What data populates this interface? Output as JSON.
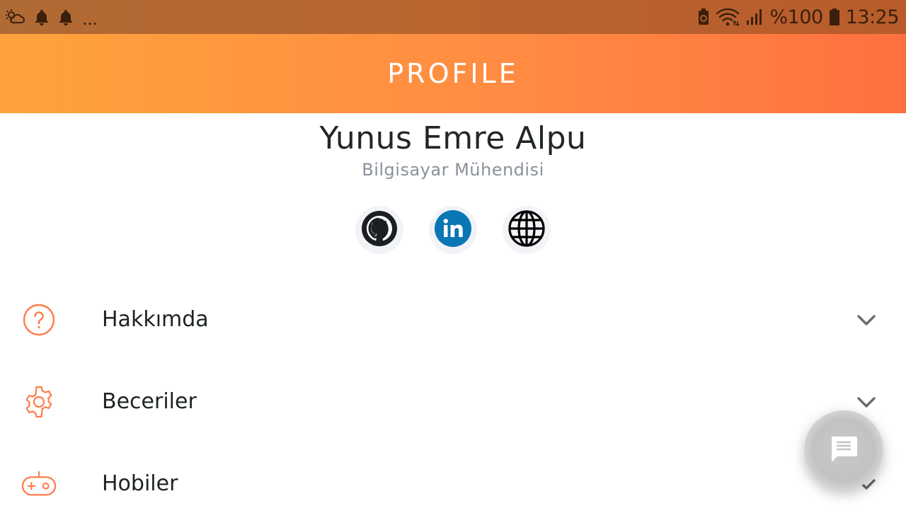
{
  "status_bar": {
    "battery_percent": "%100",
    "time": "13:25",
    "overflow": "...",
    "icons_left": [
      "weather-icon",
      "notification-bell-icon",
      "notification-bell-icon"
    ],
    "icons_right": [
      "battery-saver-icon",
      "wifi-icon",
      "signal-icon",
      "battery-icon"
    ]
  },
  "header": {
    "title": "PROFILE"
  },
  "profile": {
    "name": "Yunus Emre Alpu",
    "title": "Bilgisayar Mühendisi"
  },
  "social": [
    {
      "name": "github-icon",
      "color": "#1b1f23"
    },
    {
      "name": "linkedin-icon",
      "color": "#0a77b5"
    },
    {
      "name": "globe-icon",
      "color": "#000000"
    }
  ],
  "menu": {
    "items": [
      {
        "label": "Hakkımda",
        "icon": "help-circle-icon",
        "expanded": false
      },
      {
        "label": "Beceriler",
        "icon": "gear-icon",
        "expanded": false
      },
      {
        "label": "Hobiler",
        "icon": "gamepad-icon",
        "expanded": false
      }
    ]
  },
  "colors": {
    "accent": "#ff7c4c",
    "header_start": "#ffa23c",
    "header_end": "#ff7040",
    "chevron": "#6b6b6b"
  },
  "fab": {
    "icon": "chat-icon"
  }
}
